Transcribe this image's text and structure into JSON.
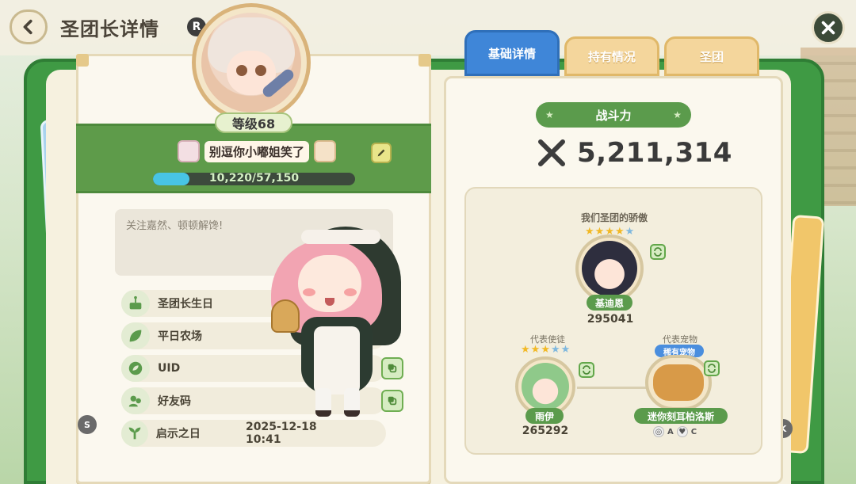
{
  "header": {
    "title": "圣团长详情",
    "badge": "R"
  },
  "profile": {
    "level_label": "等级68",
    "name": "别逗你小嘟姐笑了",
    "exp_text": "10,220/57,150",
    "exp_progress": 0.179,
    "signature": "关注嘉然、顿顿解馋!"
  },
  "info_rows": [
    {
      "label": "圣团长生日",
      "value": "",
      "icon": "cake-icon",
      "copy": false
    },
    {
      "label": "平日农场",
      "value": "",
      "icon": "leaf-icon",
      "copy": false
    },
    {
      "label": "UID",
      "value": "",
      "icon": "leaf-badge-icon",
      "copy": true
    },
    {
      "label": "好友码",
      "value": "",
      "icon": "friends-icon",
      "copy": true
    },
    {
      "label": "启示之日",
      "value": "2025-12-18 10:41",
      "icon": "sprout-icon",
      "copy": false
    }
  ],
  "keys": {
    "left": "S",
    "right": "K"
  },
  "tabs": [
    {
      "label": "基础详情",
      "active": true
    },
    {
      "label": "持有情况",
      "active": false
    },
    {
      "label": "圣团",
      "active": false
    }
  ],
  "combat": {
    "label": "战斗力",
    "value": "5,211,314"
  },
  "pride": {
    "title": "我们圣团的骄傲",
    "main": {
      "name": "基迪恩",
      "power": "295041",
      "stars": 5,
      "stars_on": 4
    },
    "companion": {
      "label": "代表使徒",
      "name": "雨伊",
      "power": "265292",
      "stars": 5,
      "stars_on": 3
    },
    "pet": {
      "label": "代表宠物",
      "badge": "稀有宠物",
      "name": "迷你刻耳柏洛斯",
      "attrs": [
        "A",
        "C"
      ]
    }
  },
  "colors": {
    "frame_green": "#3f9a44",
    "tab_active": "#3f86d8",
    "tab_inactive": "#f4d69c",
    "exp_fill": "#48c4e4"
  }
}
